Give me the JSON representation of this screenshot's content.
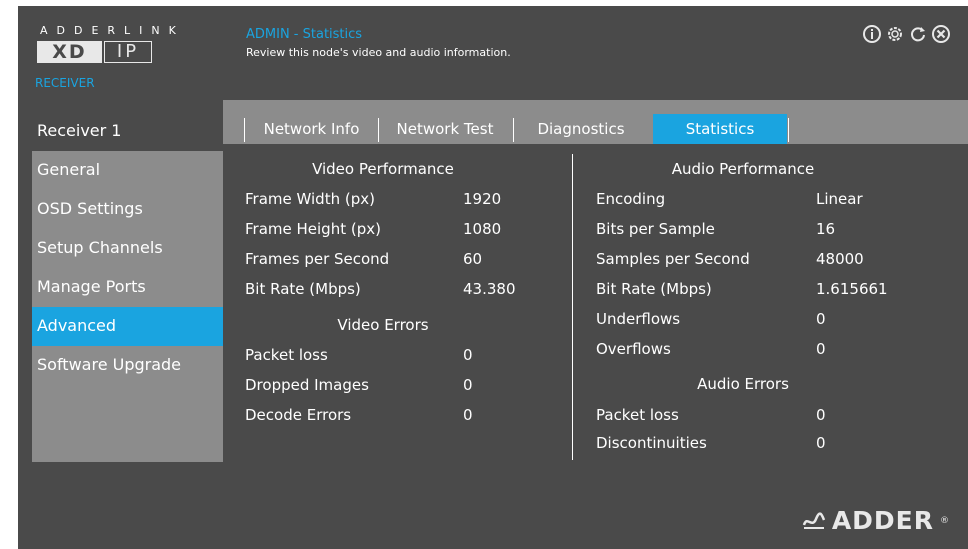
{
  "header": {
    "logo_top": "ADDERLINK",
    "logo_xd": "XD",
    "logo_ip": "IP",
    "device_role": "RECEIVER",
    "title": "ADMIN - Statistics",
    "subtitle": "Review this node's video and audio information.",
    "icons": [
      "info-icon",
      "gear-icon",
      "refresh-icon",
      "close-icon"
    ]
  },
  "sidebar": {
    "items": [
      {
        "label": "Receiver 1"
      },
      {
        "label": "General"
      },
      {
        "label": "OSD Settings"
      },
      {
        "label": "Setup Channels"
      },
      {
        "label": "Manage Ports"
      },
      {
        "label": "Advanced"
      },
      {
        "label": "Software Upgrade"
      }
    ]
  },
  "tabs": [
    {
      "label": "Network Info"
    },
    {
      "label": "Network Test"
    },
    {
      "label": "Diagnostics"
    },
    {
      "label": "Statistics"
    }
  ],
  "video": {
    "performance_title": "Video Performance",
    "performance": [
      {
        "label": "Frame Width (px)",
        "value": "1920"
      },
      {
        "label": "Frame Height (px)",
        "value": "1080"
      },
      {
        "label": "Frames per Second",
        "value": "60"
      },
      {
        "label": "Bit Rate (Mbps)",
        "value": "43.380"
      }
    ],
    "errors_title": "Video Errors",
    "errors": [
      {
        "label": "Packet loss",
        "value": "0"
      },
      {
        "label": "Dropped Images",
        "value": "0"
      },
      {
        "label": "Decode Errors",
        "value": "0"
      }
    ]
  },
  "audio": {
    "performance_title": "Audio Performance",
    "performance": [
      {
        "label": "Encoding",
        "value": "Linear"
      },
      {
        "label": "Bits per Sample",
        "value": "16"
      },
      {
        "label": "Samples per Second",
        "value": "48000"
      },
      {
        "label": "Bit Rate (Mbps)",
        "value": "1.615661"
      },
      {
        "label": "Underflows",
        "value": "0"
      },
      {
        "label": "Overflows",
        "value": "0"
      }
    ],
    "errors_title": "Audio Errors",
    "errors": [
      {
        "label": "Packet loss",
        "value": "0"
      },
      {
        "label": "Discontinuities",
        "value": "0"
      }
    ]
  },
  "brand": {
    "name": "ADDER",
    "mark": "®"
  },
  "colors": {
    "accent": "#1aa4e0",
    "panel": "#4a4a4a",
    "sidebar": "#8c8c8c"
  }
}
